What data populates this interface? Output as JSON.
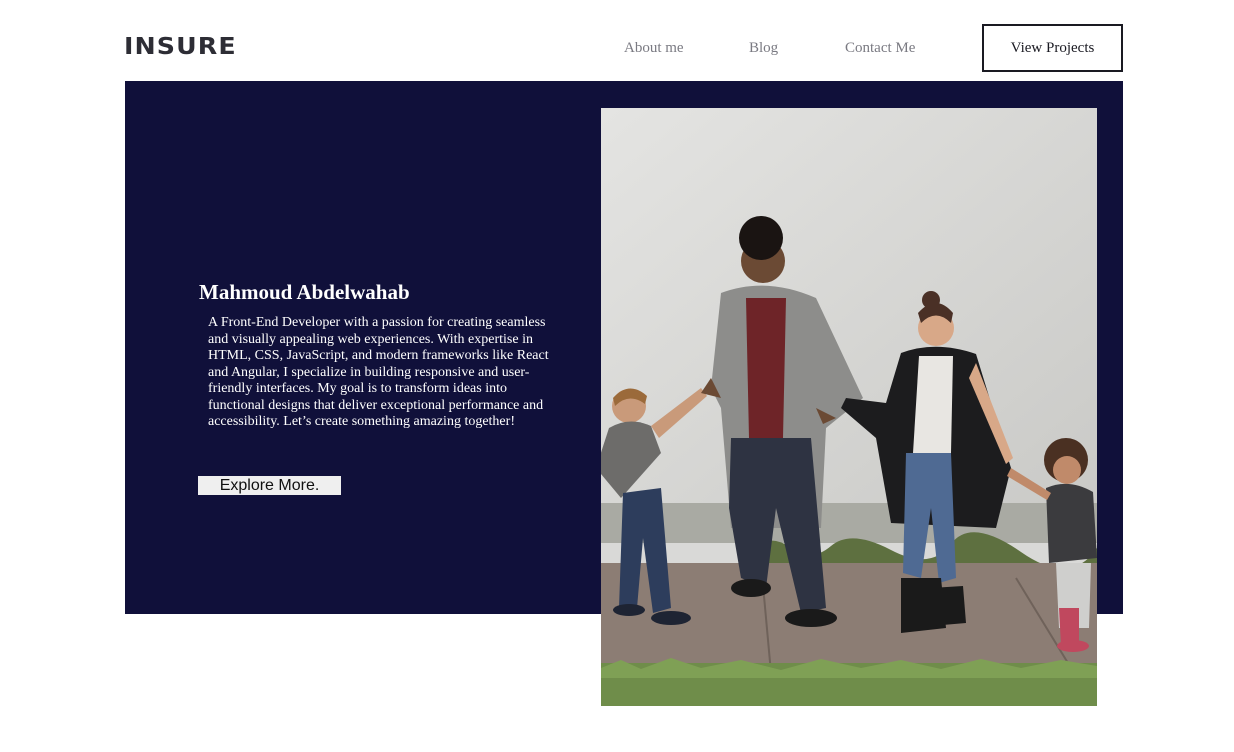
{
  "header": {
    "logo": "INSURE",
    "nav": [
      "About me",
      "Blog",
      "Contact Me"
    ],
    "cta_label": "View Projects"
  },
  "hero": {
    "title": "Mahmoud Abdelwahab",
    "description": "A Front-End Developer with a passion for creating seamless and visually appealing web experiences. With expertise in HTML, CSS, JavaScript, and modern frameworks like React and Angular, I specialize in building responsive and user-friendly interfaces. My goal is to transform ideas into functional designs that deliver exceptional performance and accessibility. Let’s create something amazing together!",
    "button_label": "Explore More.",
    "background_color": "#10103a"
  },
  "photo": {
    "subject": "family-walking-photo"
  }
}
